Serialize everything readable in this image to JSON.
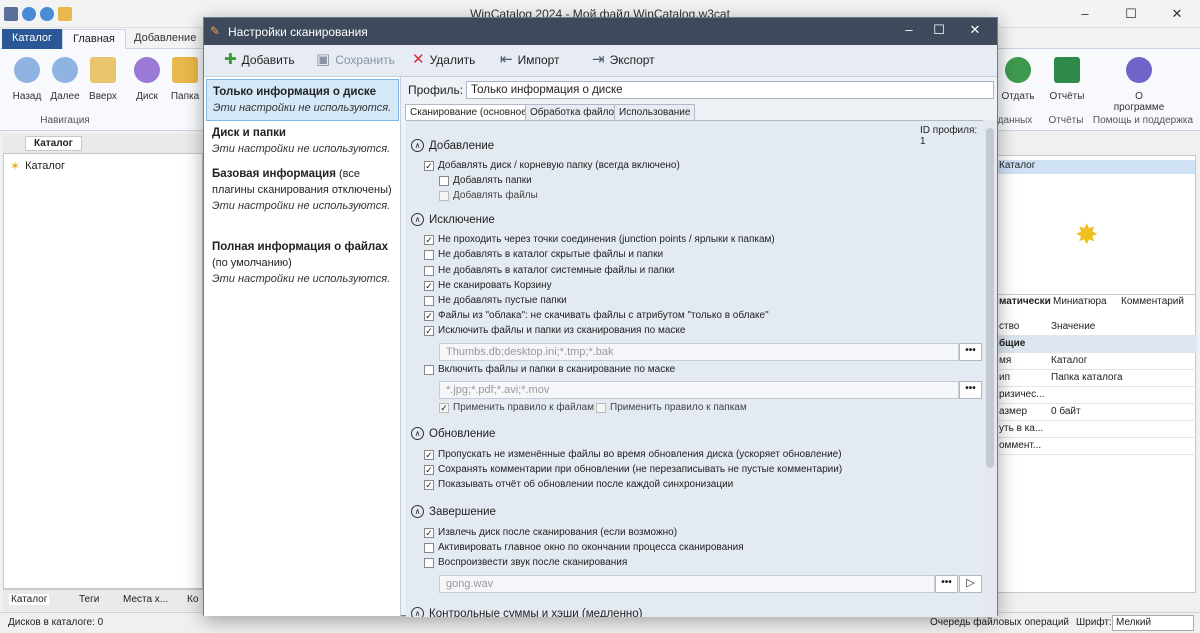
{
  "app": {
    "title": "WinCatalog 2024 - Мой файл WinCatalog.w3cat"
  },
  "ribbon": {
    "tabs": [
      "Каталог",
      "Главная",
      "Добавление"
    ],
    "buttons": {
      "back": "Назад",
      "forward": "Далее",
      "up": "Вверх",
      "disk": "Диск",
      "folder": "Папка",
      "give": "Отдать",
      "reports": "Отчёты",
      "about": "О программе"
    },
    "groups": {
      "nav": "Навигация",
      "data": "данных",
      "reports": "Отчёты",
      "help": "Помощь и поддержка"
    }
  },
  "left": {
    "tab": "Каталог",
    "tree_root": "Каталог",
    "bottom_tabs": [
      "Каталог",
      "Теги",
      "Места х...",
      "Ко"
    ]
  },
  "right": {
    "header": "Каталог",
    "tabs": [
      "матически",
      "Миниатюра",
      "Комментарий"
    ],
    "cols": [
      "ство",
      "Значение"
    ],
    "group": "бщие",
    "rows": [
      [
        "мя",
        "Каталог"
      ],
      [
        "ип",
        "Папка каталога"
      ],
      [
        "ризичес...",
        ""
      ],
      [
        "азмер",
        "0 байт"
      ],
      [
        "уть в ка...",
        ""
      ],
      [
        "оммент...",
        ""
      ]
    ]
  },
  "status": {
    "left": "Дисков в каталоге: 0",
    "queue": "Очередь файловых операций",
    "font_label": "Шрифт:",
    "font": "Мелкий"
  },
  "dialog": {
    "title": "Настройки сканирования",
    "toolbar": {
      "add": "Добавить",
      "save": "Сохранить",
      "delete": "Удалить",
      "import": "Импорт",
      "export": "Экспорт"
    },
    "profiles": [
      {
        "name": "Только информация о диске",
        "desc": "Эти настройки не используются."
      },
      {
        "name": "Диск и папки",
        "desc": "Эти настройки не используются."
      },
      {
        "name": "Базовая информация",
        "extra": " (все плагины сканирования отключены)",
        "desc": "Эти настройки не используются."
      },
      {
        "name": "Полная информация о файлах",
        "extra": " (по умолчанию)",
        "desc": "Эти настройки не используются."
      }
    ],
    "profile_label": "Профиль:",
    "profile_value": "Только информация о диске",
    "tabs": [
      "Сканирование (основное)",
      "Обработка файлов",
      "Использование"
    ],
    "profile_id": "ID профиля: 1",
    "sections": {
      "add": "Добавление",
      "excl": "Исключение",
      "upd": "Обновление",
      "fin": "Завершение",
      "hash": "Контрольные суммы и хэши (медленно)"
    },
    "opts": {
      "add_disk": "Добавлять диск / корневую папку (всегда включено)",
      "add_folders": "Добавлять папки",
      "add_files": "Добавлять файлы",
      "junction": "Не проходить через точки соединения (junction points / ярлыки к папкам)",
      "hidden": "Не добавлять в каталог скрытые файлы и папки",
      "system": "Не добавлять в каталог системные файлы и папки",
      "recycle": "Не сканировать Корзину",
      "empty": "Не добавлять пустые папки",
      "cloud": "Файлы из \"облака\": не скачивать файлы с атрибутом \"только в облаке\"",
      "excl_mask": "Исключить файлы и папки из сканирования по маске",
      "excl_mask_val": "Thumbs.db;desktop.ini;*.tmp;*.bak",
      "incl_mask": "Включить файлы и папки в сканирование по маске",
      "incl_mask_val": "*.jpg;*.pdf;*.avi;*.mov",
      "rule_files": "Применить правило к файлам",
      "rule_folders": "Применить правило к папкам",
      "skip_unchanged": "Пропускать не изменённые файлы во время обновления диска (ускоряет обновление)",
      "keep_comments": "Сохранять комментарии при обновлении (не перезаписывать не пустые комментарии)",
      "show_report": "Показывать отчёт об обновлении после каждой синхронизации",
      "eject": "Извлечь диск после сканирования (если возможно)",
      "activate": "Активировать главное окно по окончании процесса сканирования",
      "sound": "Воспроизвести звук после сканирования",
      "sound_val": "gong.wav"
    }
  }
}
